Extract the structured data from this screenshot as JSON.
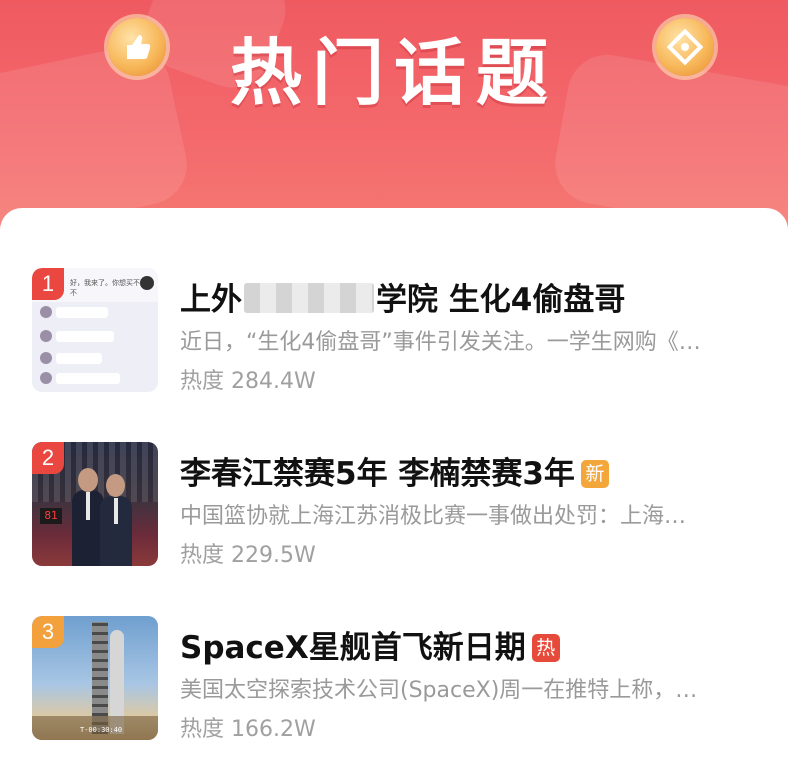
{
  "banner": {
    "title": "热门话题"
  },
  "items": [
    {
      "rank": "1",
      "title_pre": "上外",
      "title_post": "学院 生化4偷盘哥",
      "desc": "近日，“生化4偷盘哥”事件引发关注。一学生网购《…",
      "heat": "热度 284.4W",
      "rank_color": "#e9473f",
      "chat_text": "好，我来了。你想买不还是不"
    },
    {
      "rank": "2",
      "title": "李春江禁赛5年 李楠禁赛3年",
      "tag": "新",
      "tag_color": "#f3a63a",
      "desc": "中国篮协就上海江苏消极比赛一事做出处罚：上海…",
      "heat": "热度 229.5W",
      "rank_color": "#e9473f",
      "score": "81"
    },
    {
      "rank": "3",
      "title": "SpaceX星舰首飞新日期",
      "tag": "热",
      "tag_color": "#e64a3b",
      "desc": "美国太空探索技术公司(SpaceX)周一在推特上称，…",
      "heat": "热度 166.2W",
      "rank_color": "#f2a13c",
      "timestamp": "T-00:30:40"
    }
  ]
}
